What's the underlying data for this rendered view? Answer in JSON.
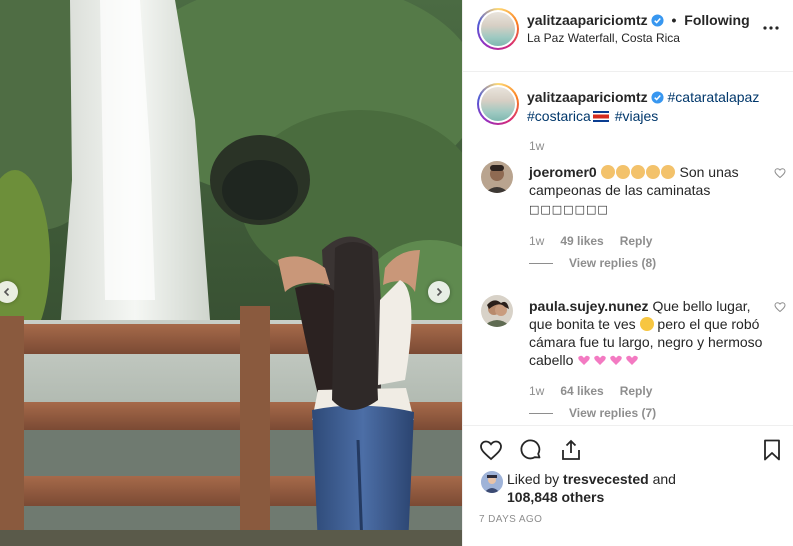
{
  "post": {
    "photo_alt": "Woman with long dark hair facing a waterfall behind a wooden railing"
  },
  "header": {
    "username": "yalitzaapariciomtz",
    "separator": "•",
    "follow_status": "Following",
    "location": "La Paz Waterfall, Costa Rica"
  },
  "caption": {
    "username": "yalitzaapariciomtz",
    "tags": [
      "#catarata​lapaz",
      "#costarica",
      "#viajes"
    ],
    "tag1": "#cataratalapaz",
    "tag2": "#costarica",
    "tag3": "#viajes",
    "time": "1w"
  },
  "comments": [
    {
      "username": "joeromer0",
      "text_after_emojis": " Son unas campeonas de las caminatas",
      "trailing_glyphs": "□□□□□□□",
      "time": "1w",
      "likes": "49 likes",
      "reply_label": "Reply",
      "view_replies": "View replies (8)"
    },
    {
      "username": "paula.sujey.nunez",
      "text_part1": "Que bello lugar, que bonita te ves",
      "text_part2": " pero el que robó cámara fue tu largo, negro y hermoso cabello",
      "time": "1w",
      "likes": "64 likes",
      "reply_label": "Reply",
      "view_replies": "View replies (7)"
    }
  ],
  "likes": {
    "prefix": "Liked by",
    "user": "tresvecested",
    "and": "and",
    "count": "108,848 others"
  },
  "timestamp": "7 DAYS AGO",
  "colors": {
    "verified": "#3897f0",
    "link": "#00376b",
    "muted": "#8e8e8e",
    "text": "#262626"
  },
  "icons": [
    "chevron-left-icon",
    "chevron-right-icon",
    "more-options-icon",
    "verified-badge-icon",
    "heart-outline-icon",
    "comment-icon",
    "share-icon",
    "bookmark-icon"
  ]
}
